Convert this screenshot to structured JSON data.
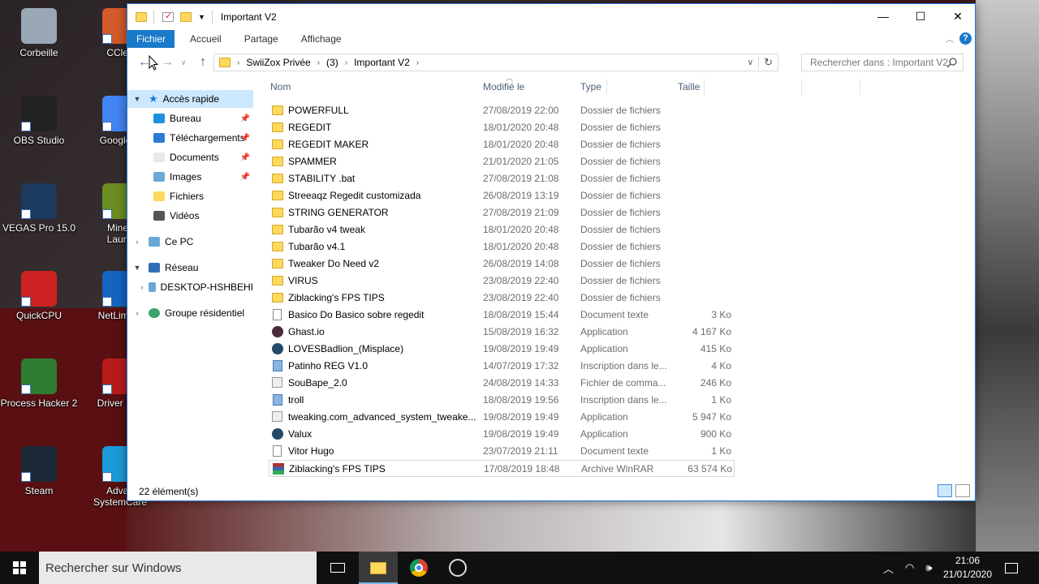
{
  "desktop": {
    "icons": [
      {
        "label": "Corbeille",
        "icon": "recycle-bin-icon"
      },
      {
        "label": "CClea",
        "icon": "ccleaner-icon"
      },
      {
        "label": "OBS Studio",
        "icon": "obs-icon"
      },
      {
        "label": "Google C",
        "icon": "chrome-icon"
      },
      {
        "label": "VEGAS Pro 15.0",
        "icon": "vegas-icon"
      },
      {
        "label": "Minec\nLaunc",
        "icon": "minecraft-icon"
      },
      {
        "label": "QuickCPU",
        "icon": "quickcpu-icon"
      },
      {
        "label": "NetLimiter",
        "icon": "netlimiter-icon"
      },
      {
        "label": "Process Hacker 2",
        "icon": "process-hacker-icon"
      },
      {
        "label": "Driver Boo",
        "icon": "driver-booster-icon"
      },
      {
        "label": "Steam",
        "icon": "steam-icon"
      },
      {
        "label": "Advan\nSystemCare",
        "icon": "advanced-systemcare-icon"
      }
    ]
  },
  "window": {
    "title": "Important V2",
    "controls": {
      "minimize": "—",
      "maximize": "☐",
      "close": "✕"
    },
    "ribbon": {
      "tabs": [
        "Fichier",
        "Accueil",
        "Partage",
        "Affichage"
      ],
      "help": "?"
    },
    "address": {
      "crumbs": [
        "SwiiZox Privée",
        "(3)",
        "Important V2"
      ]
    },
    "search": {
      "placeholder": "Rechercher dans : Important V2"
    },
    "nav": {
      "quick_access": "Accès rapide",
      "items": [
        {
          "label": "Bureau",
          "pinned": true,
          "color": "#1e90e0"
        },
        {
          "label": "Téléchargements",
          "pinned": true,
          "color": "#2a7bd4"
        },
        {
          "label": "Documents",
          "pinned": true,
          "color": "#e8e8e8"
        },
        {
          "label": "Images",
          "pinned": true,
          "color": "#6aa8d8"
        },
        {
          "label": "Fichiers",
          "pinned": false,
          "color": "#ffd85e"
        },
        {
          "label": "Vidéos",
          "pinned": false,
          "color": "#555555"
        }
      ],
      "this_pc": "Ce PC",
      "network": "Réseau",
      "network_child": "DESKTOP-HSHBEHI",
      "homegroup": "Groupe résidentiel"
    },
    "columns": {
      "name": "Nom",
      "date": "Modifié le",
      "type": "Type",
      "size": "Taille"
    },
    "files": [
      {
        "name": "POWERFULL",
        "date": "27/08/2019 22:00",
        "type": "Dossier de fichiers",
        "size": "",
        "icon": "folder"
      },
      {
        "name": "REGEDIT",
        "date": "18/01/2020 20:48",
        "type": "Dossier de fichiers",
        "size": "",
        "icon": "folder"
      },
      {
        "name": "REGEDIT MAKER",
        "date": "18/01/2020 20:48",
        "type": "Dossier de fichiers",
        "size": "",
        "icon": "folder"
      },
      {
        "name": "SPAMMER",
        "date": "21/01/2020 21:05",
        "type": "Dossier de fichiers",
        "size": "",
        "icon": "folder"
      },
      {
        "name": "STABILITY .bat",
        "date": "27/08/2019 21:08",
        "type": "Dossier de fichiers",
        "size": "",
        "icon": "folder"
      },
      {
        "name": "Streeaqz Regedit customizada",
        "date": "26/08/2019 13:19",
        "type": "Dossier de fichiers",
        "size": "",
        "icon": "folder"
      },
      {
        "name": "STRING GENERATOR",
        "date": "27/08/2019 21:09",
        "type": "Dossier de fichiers",
        "size": "",
        "icon": "folder"
      },
      {
        "name": "Tubarão v4 tweak",
        "date": "18/01/2020 20:48",
        "type": "Dossier de fichiers",
        "size": "",
        "icon": "folder"
      },
      {
        "name": "Tubarão v4.1",
        "date": "18/01/2020 20:48",
        "type": "Dossier de fichiers",
        "size": "",
        "icon": "folder"
      },
      {
        "name": "Tweaker Do Need v2",
        "date": "26/08/2019 14:08",
        "type": "Dossier de fichiers",
        "size": "",
        "icon": "folder"
      },
      {
        "name": "VIRUS",
        "date": "23/08/2019 22:40",
        "type": "Dossier de fichiers",
        "size": "",
        "icon": "folder"
      },
      {
        "name": "Ziblacking's FPS TIPS",
        "date": "23/08/2019 22:40",
        "type": "Dossier de fichiers",
        "size": "",
        "icon": "folder"
      },
      {
        "name": "Basico Do Basico sobre regedit",
        "date": "18/08/2019 15:44",
        "type": "Document texte",
        "size": "3 Ko",
        "icon": "txt"
      },
      {
        "name": "Ghast.io",
        "date": "15/08/2019 16:32",
        "type": "Application",
        "size": "4 167 Ko",
        "icon": "app"
      },
      {
        "name": "LOVESBadlion_(Misplace)",
        "date": "19/08/2019 19:49",
        "type": "Application",
        "size": "415 Ko",
        "icon": "app2"
      },
      {
        "name": "Patinho REG V1.0",
        "date": "14/07/2019 17:32",
        "type": "Inscription dans le...",
        "size": "4 Ko",
        "icon": "reg"
      },
      {
        "name": "SouBape_2.0",
        "date": "24/08/2019 14:33",
        "type": "Fichier de comma...",
        "size": "246 Ko",
        "icon": "cmd"
      },
      {
        "name": "troll",
        "date": "18/08/2019 19:56",
        "type": "Inscription dans le...",
        "size": "1 Ko",
        "icon": "reg"
      },
      {
        "name": "tweaking.com_advanced_system_tweake...",
        "date": "19/08/2019 19:49",
        "type": "Application",
        "size": "5 947 Ko",
        "icon": "cmd"
      },
      {
        "name": "Valux",
        "date": "19/08/2019 19:49",
        "type": "Application",
        "size": "900 Ko",
        "icon": "app2"
      },
      {
        "name": "Vitor Hugo",
        "date": "23/07/2019 21:11",
        "type": "Document texte",
        "size": "1 Ko",
        "icon": "txt"
      },
      {
        "name": "Ziblacking's FPS TIPS",
        "date": "17/08/2019 18:48",
        "type": "Archive WinRAR",
        "size": "63 574 Ko",
        "icon": "rar"
      }
    ],
    "status": "22 élément(s)"
  },
  "taskbar": {
    "search_placeholder": "Rechercher sur Windows",
    "time": "21:06",
    "date": "21/01/2020"
  }
}
